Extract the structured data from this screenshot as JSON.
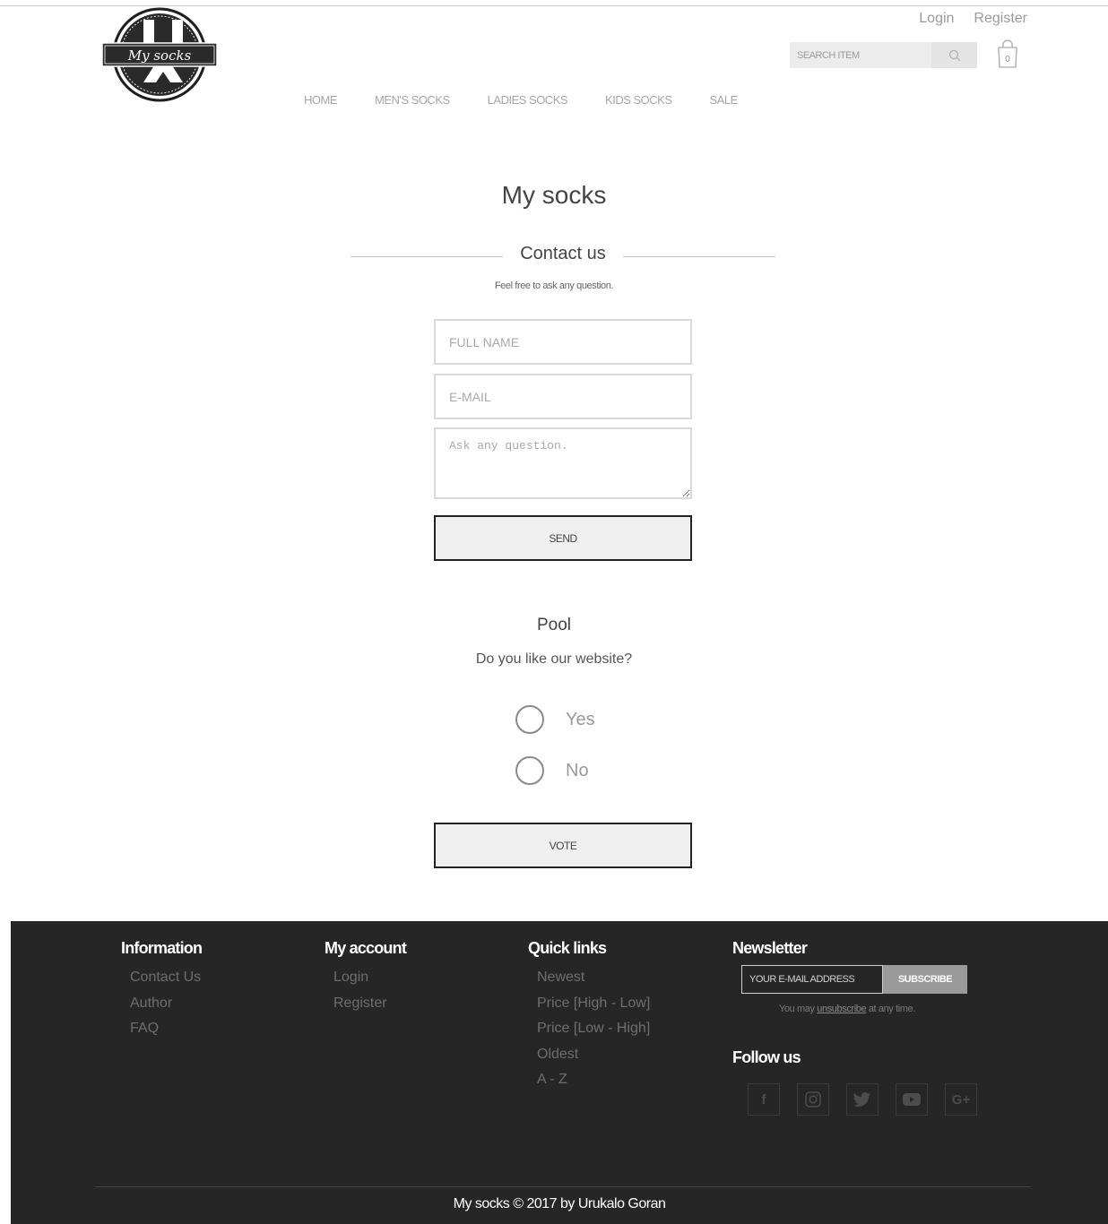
{
  "header": {
    "logo_text": "My socks",
    "login": "Login",
    "register": "Register",
    "search_placeholder": "SEARCH ITEM",
    "cart_count": "0",
    "nav": [
      "HOME",
      "MEN'S SOCKS",
      "LADIES SOCKS",
      "KIDS SOCKS",
      "SALE"
    ]
  },
  "main": {
    "site_title": "My socks",
    "section_title": "Contact us",
    "subtitle": "Feel free to ask any question.",
    "form": {
      "name_placeholder": "FULL NAME",
      "email_placeholder": "E-MAIL",
      "question_placeholder": "Ask any question.",
      "send_label": "SEND"
    },
    "poll": {
      "title": "Pool",
      "question": "Do you like our website?",
      "options": [
        "Yes",
        "No"
      ],
      "vote_label": "VOTE"
    }
  },
  "footer": {
    "information": {
      "title": "Information",
      "links": [
        "Contact Us",
        "Author",
        "FAQ"
      ]
    },
    "account": {
      "title": "My account",
      "links": [
        "Login",
        "Register"
      ]
    },
    "quick_links": {
      "title": "Quick links",
      "links": [
        "Newest",
        "Price [High - Low]",
        "Price [Low - High]",
        "Oldest",
        "A - Z"
      ]
    },
    "newsletter": {
      "title": "Newsletter",
      "placeholder": "YOUR E-MAIL ADDRESS",
      "button": "SUBSCRIBE",
      "note_prefix": "You may ",
      "note_link": "unsubscribe",
      "note_suffix": " at any time."
    },
    "follow_title": "Follow us",
    "socials": [
      "facebook-icon",
      "instagram-icon",
      "twitter-icon",
      "youtube-icon",
      "google-plus-icon"
    ],
    "copyright": "My socks © 2017 by Urukalo Goran"
  }
}
